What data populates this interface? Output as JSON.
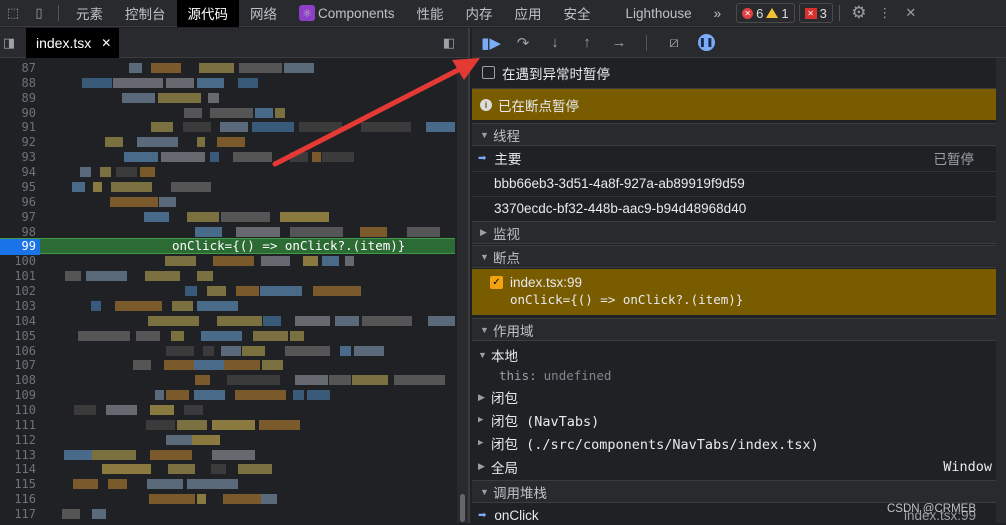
{
  "topbar": {
    "tabs": [
      "元素",
      "控制台",
      "源代码",
      "网络",
      "Components",
      "性能",
      "内存",
      "应用",
      "安全",
      "Lighthouse"
    ],
    "active": "源代码",
    "more": "»",
    "errors": "6",
    "warnings": "1",
    "issues": "3"
  },
  "editor": {
    "file_tab": "index.tsx",
    "line_numbers": [
      87,
      88,
      89,
      90,
      91,
      92,
      93,
      94,
      95,
      96,
      97,
      98,
      99,
      100,
      101,
      102,
      103,
      104,
      105,
      106,
      107,
      108,
      109,
      110,
      111,
      112,
      113,
      114,
      115,
      116,
      117
    ],
    "current_line": 99,
    "current_code": "onClick={() => onClick?.(item)}"
  },
  "debugger": {
    "pause_on_exceptions": "在遇到异常时暂停",
    "paused_banner": "已在断点暂停",
    "threads": {
      "title": "线程",
      "main": "主要",
      "main_status": "已暂停",
      "others": [
        "bbb66eb3-3d51-4a8f-927a-ab89919f9d59",
        "3370ecdc-bf32-448b-aac9-b94d48968d40"
      ]
    },
    "watch": {
      "title": "监视"
    },
    "breakpoints": {
      "title": "断点",
      "file": "index.tsx:99",
      "code": "onClick={() => onClick?.(item)}"
    },
    "scope": {
      "title": "作用域",
      "local": "本地",
      "this_key": "this:",
      "this_val": "undefined",
      "closure1": "闭包",
      "closure2": "闭包 (NavTabs)",
      "closure3": "闭包 (./src/components/NavTabs/index.tsx)",
      "global": "全局",
      "global_val": "Window"
    },
    "callstack": {
      "title": "调用堆栈",
      "frame": "onClick",
      "location": "index.tsx:99"
    }
  },
  "watermark": "CSDN @CRMEB",
  "colors": {
    "paused": "#7a5c00",
    "current_line": "#2d6b35",
    "annotation_arrow": "#e53935"
  }
}
